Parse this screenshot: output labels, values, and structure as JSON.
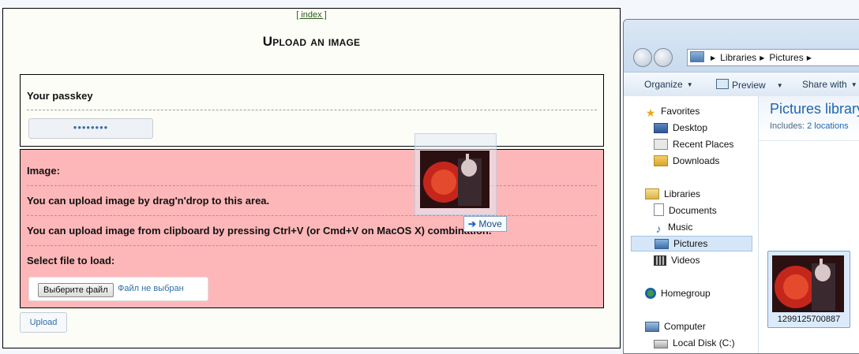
{
  "web": {
    "index_link": "[ index ]",
    "title": "Upload an image",
    "passkey_label": "Your passkey",
    "passkey_value": "••••••••",
    "image_label": "Image:",
    "drag_hint": "You can upload image by drag'n'drop to this area.",
    "clipboard_hint": "You can upload image from clipboard by pressing Ctrl+V (or Cmd+V on MacOS X) combination.",
    "select_label": "Select file to load:",
    "file_button": "Выберите файл",
    "file_status": "Файл не выбран",
    "upload_button": "Upload"
  },
  "drag": {
    "tooltip": "Move"
  },
  "explorer": {
    "breadcrumb": [
      "Libraries",
      "Pictures"
    ],
    "toolbar": {
      "organize": "Organize",
      "preview": "Preview",
      "share": "Share with"
    },
    "nav": {
      "favorites": "Favorites",
      "desktop": "Desktop",
      "recent": "Recent Places",
      "downloads": "Downloads",
      "libraries": "Libraries",
      "documents": "Documents",
      "music": "Music",
      "pictures": "Pictures",
      "videos": "Videos",
      "homegroup": "Homegroup",
      "computer": "Computer",
      "local_disk": "Local Disk (C:)"
    },
    "library_title": "Pictures library",
    "includes_label": "Includes:",
    "includes_link": "2 locations",
    "file_name": "1299125700887"
  }
}
